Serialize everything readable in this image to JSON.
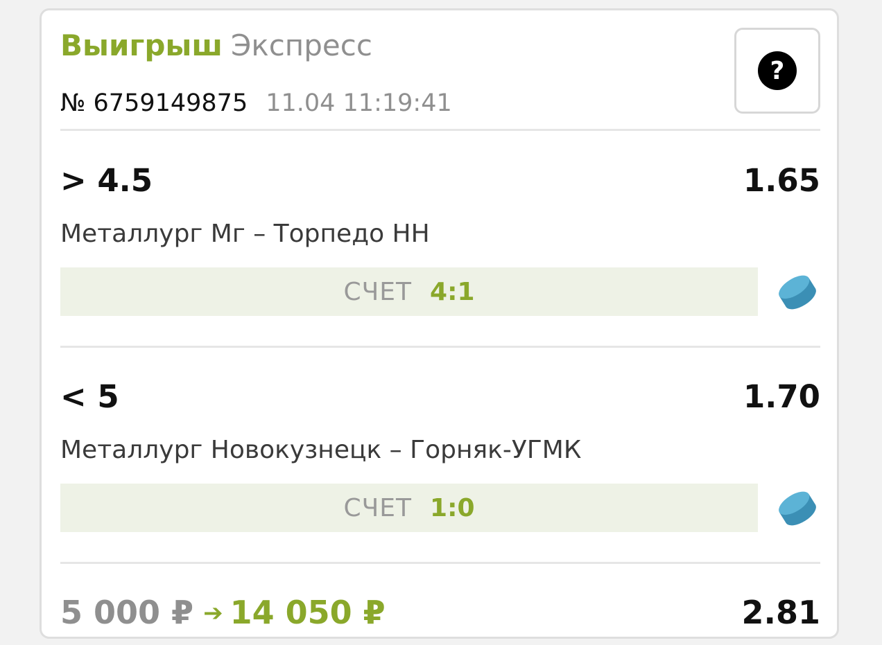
{
  "bet": {
    "result": "Выигрыш",
    "type": "Экспресс",
    "number": "№ 6759149875",
    "datetime": "11.04 11:19:41",
    "help_label": "?"
  },
  "events": [
    {
      "outcome": "> 4.5",
      "coef": "1.65",
      "match": "Металлург Мг – Торпедо НН",
      "score_label": "СЧЕТ",
      "score": "4:1",
      "sport_icon": "hockey-puck-icon"
    },
    {
      "outcome": "< 5",
      "coef": "1.70",
      "match": "Металлург Новокузнецк – Горняк-УГМК",
      "score_label": "СЧЕТ",
      "score": "1:0",
      "sport_icon": "hockey-puck-icon"
    }
  ],
  "footer": {
    "stake": "5 000 ₽",
    "arrow": "➔",
    "win": "14 050 ₽",
    "total_coef": "2.81"
  },
  "colors": {
    "accent_green": "#8aa82b",
    "score_bg": "#eef2e6",
    "puck_blue": "#4aa3c8"
  }
}
